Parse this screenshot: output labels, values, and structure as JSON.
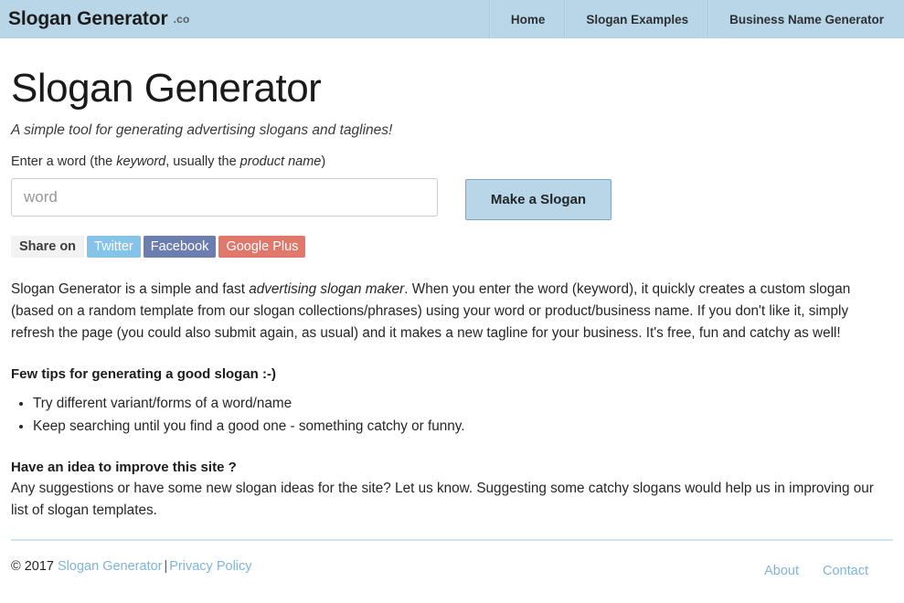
{
  "header": {
    "brand_name": "Slogan Generator",
    "brand_tld": ".co",
    "nav": [
      {
        "label": "Home"
      },
      {
        "label": "Slogan Examples"
      },
      {
        "label": "Business Name Generator"
      }
    ],
    "background_color": "#b8d6e8"
  },
  "main": {
    "title": "Slogan Generator",
    "subtitle": "A simple tool for generating advertising slogans and taglines!",
    "field_label": {
      "part1": "Enter a word (the ",
      "em1": "keyword",
      "part2": ", usually the ",
      "em2": "product name",
      "part3": ")"
    },
    "input": {
      "placeholder": "word",
      "value": ""
    },
    "submit_label": "Make a Slogan",
    "share": {
      "label": "Share on",
      "buttons": [
        {
          "label": "Twitter",
          "color": "#85c3e8"
        },
        {
          "label": "Facebook",
          "color": "#6c7eb0"
        },
        {
          "label": "Google Plus",
          "color": "#e0786c"
        }
      ]
    },
    "intro": {
      "part1": "Slogan Generator is a simple and fast ",
      "em1": "advertising slogan maker",
      "part2": ". When you enter the word (keyword), it quickly creates a custom slogan (based on a random template from our slogan collections/phrases) using your word or product/business name. If you don't like it, simply refresh the page (you could also submit again, as usual) and it makes a new tagline for your business. It's free, fun and catchy as well!"
    },
    "tips_heading": "Few tips for generating a good slogan :-)",
    "tips": [
      "Try different variant/forms of a word/name",
      "Keep searching until you find a good one - something catchy or funny."
    ],
    "idea_heading": "Have an idea to improve this site ?",
    "idea_body": "Any suggestions or have some new slogan ideas for the site? Let us know. Suggesting some catchy slogans would help us in improving our list of slogan templates."
  },
  "footer": {
    "copyright_prefix": "© 2017",
    "site_link": "Slogan Generator",
    "separator": "|",
    "privacy_link": "Privacy Policy",
    "links": [
      {
        "label": "About"
      },
      {
        "label": "Contact"
      }
    ],
    "link_color": "#7fb5d9"
  }
}
